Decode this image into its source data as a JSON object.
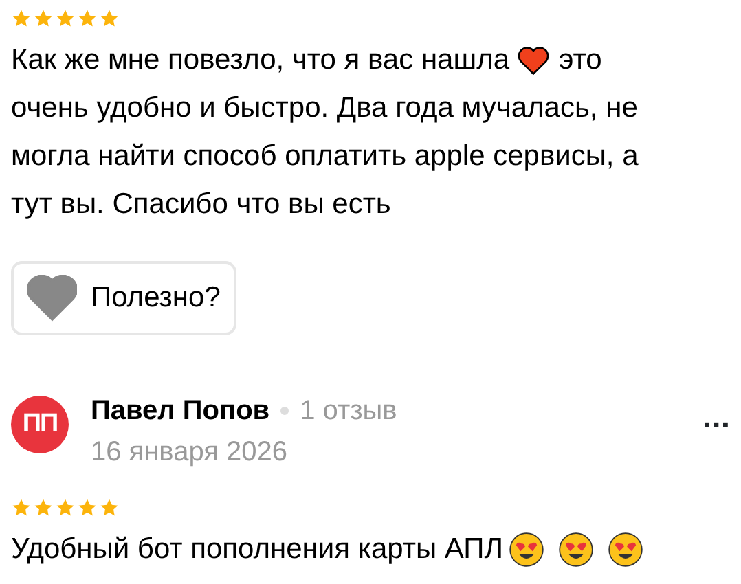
{
  "reviews": [
    {
      "stars": 5,
      "lines": [
        [
          {
            "kind": "text",
            "text": "Как же мне повезло, что я вас нашла"
          },
          {
            "kind": "heart"
          },
          {
            "kind": "text",
            "text": "это"
          }
        ],
        [
          {
            "kind": "text",
            "text": "очень удобно и быстро. Два года мучалась, не"
          }
        ],
        [
          {
            "kind": "text",
            "text": "могла найти способ оплатить apple сервисы, а"
          }
        ],
        [
          {
            "kind": "text",
            "text": "тут вы. Спасибо что вы есть"
          }
        ]
      ],
      "helpful_button": "Полезно?"
    },
    {
      "avatar_initials": "ПП",
      "author": "Павел Попов",
      "review_count": "1 отзыв",
      "date": "16 января 2026",
      "menu": "...",
      "stars": 5,
      "lines": [
        [
          {
            "kind": "text",
            "text": "Удобный бот пополнения карты АПЛ"
          },
          {
            "kind": "smiley"
          },
          {
            "kind": "smiley"
          },
          {
            "kind": "smiley"
          }
        ]
      ]
    }
  ]
}
